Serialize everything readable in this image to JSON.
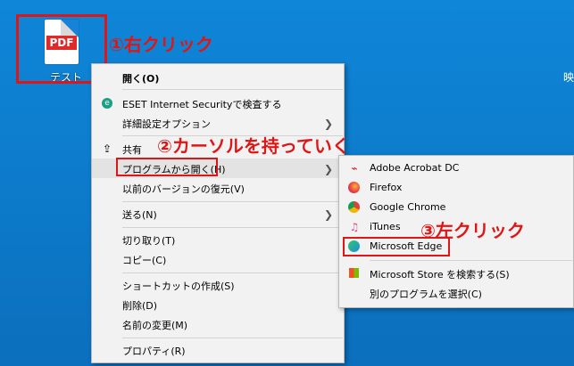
{
  "desktop": {
    "file": {
      "icon_label": "PDF",
      "name": "テスト"
    },
    "right_edge_text": "映"
  },
  "annotations": {
    "step1": "①右クリック",
    "step2": "②カーソルを持っていく",
    "step3": "③左クリック"
  },
  "context_menu": {
    "items": [
      {
        "label": "開く(O)"
      },
      {
        "label": "ESET Internet Securityで検査する",
        "icon": "eset-icon"
      },
      {
        "label": "詳細設定オプション",
        "submenu": true
      },
      {
        "label": "共有",
        "icon": "share-icon"
      },
      {
        "label": "プログラムから開く(H)",
        "submenu": true
      },
      {
        "label": "以前のバージョンの復元(V)"
      },
      {
        "label": "送る(N)",
        "submenu": true
      },
      {
        "label": "切り取り(T)"
      },
      {
        "label": "コピー(C)"
      },
      {
        "label": "ショートカットの作成(S)"
      },
      {
        "label": "削除(D)"
      },
      {
        "label": "名前の変更(M)"
      },
      {
        "label": "プロパティ(R)"
      }
    ]
  },
  "submenu": {
    "items": [
      {
        "label": "Adobe Acrobat DC",
        "icon": "adobe-acrobat-icon"
      },
      {
        "label": "Firefox",
        "icon": "firefox-icon"
      },
      {
        "label": "Google Chrome",
        "icon": "chrome-icon"
      },
      {
        "label": "iTunes",
        "icon": "itunes-icon"
      },
      {
        "label": "Microsoft Edge",
        "icon": "edge-icon"
      },
      {
        "label": "Microsoft Store を検索する(S)",
        "icon": "store-icon"
      },
      {
        "label": "別のプログラムを選択(C)"
      }
    ]
  },
  "colors": {
    "highlight_red": "#e01616",
    "desktop_blue": "#1683d8"
  }
}
